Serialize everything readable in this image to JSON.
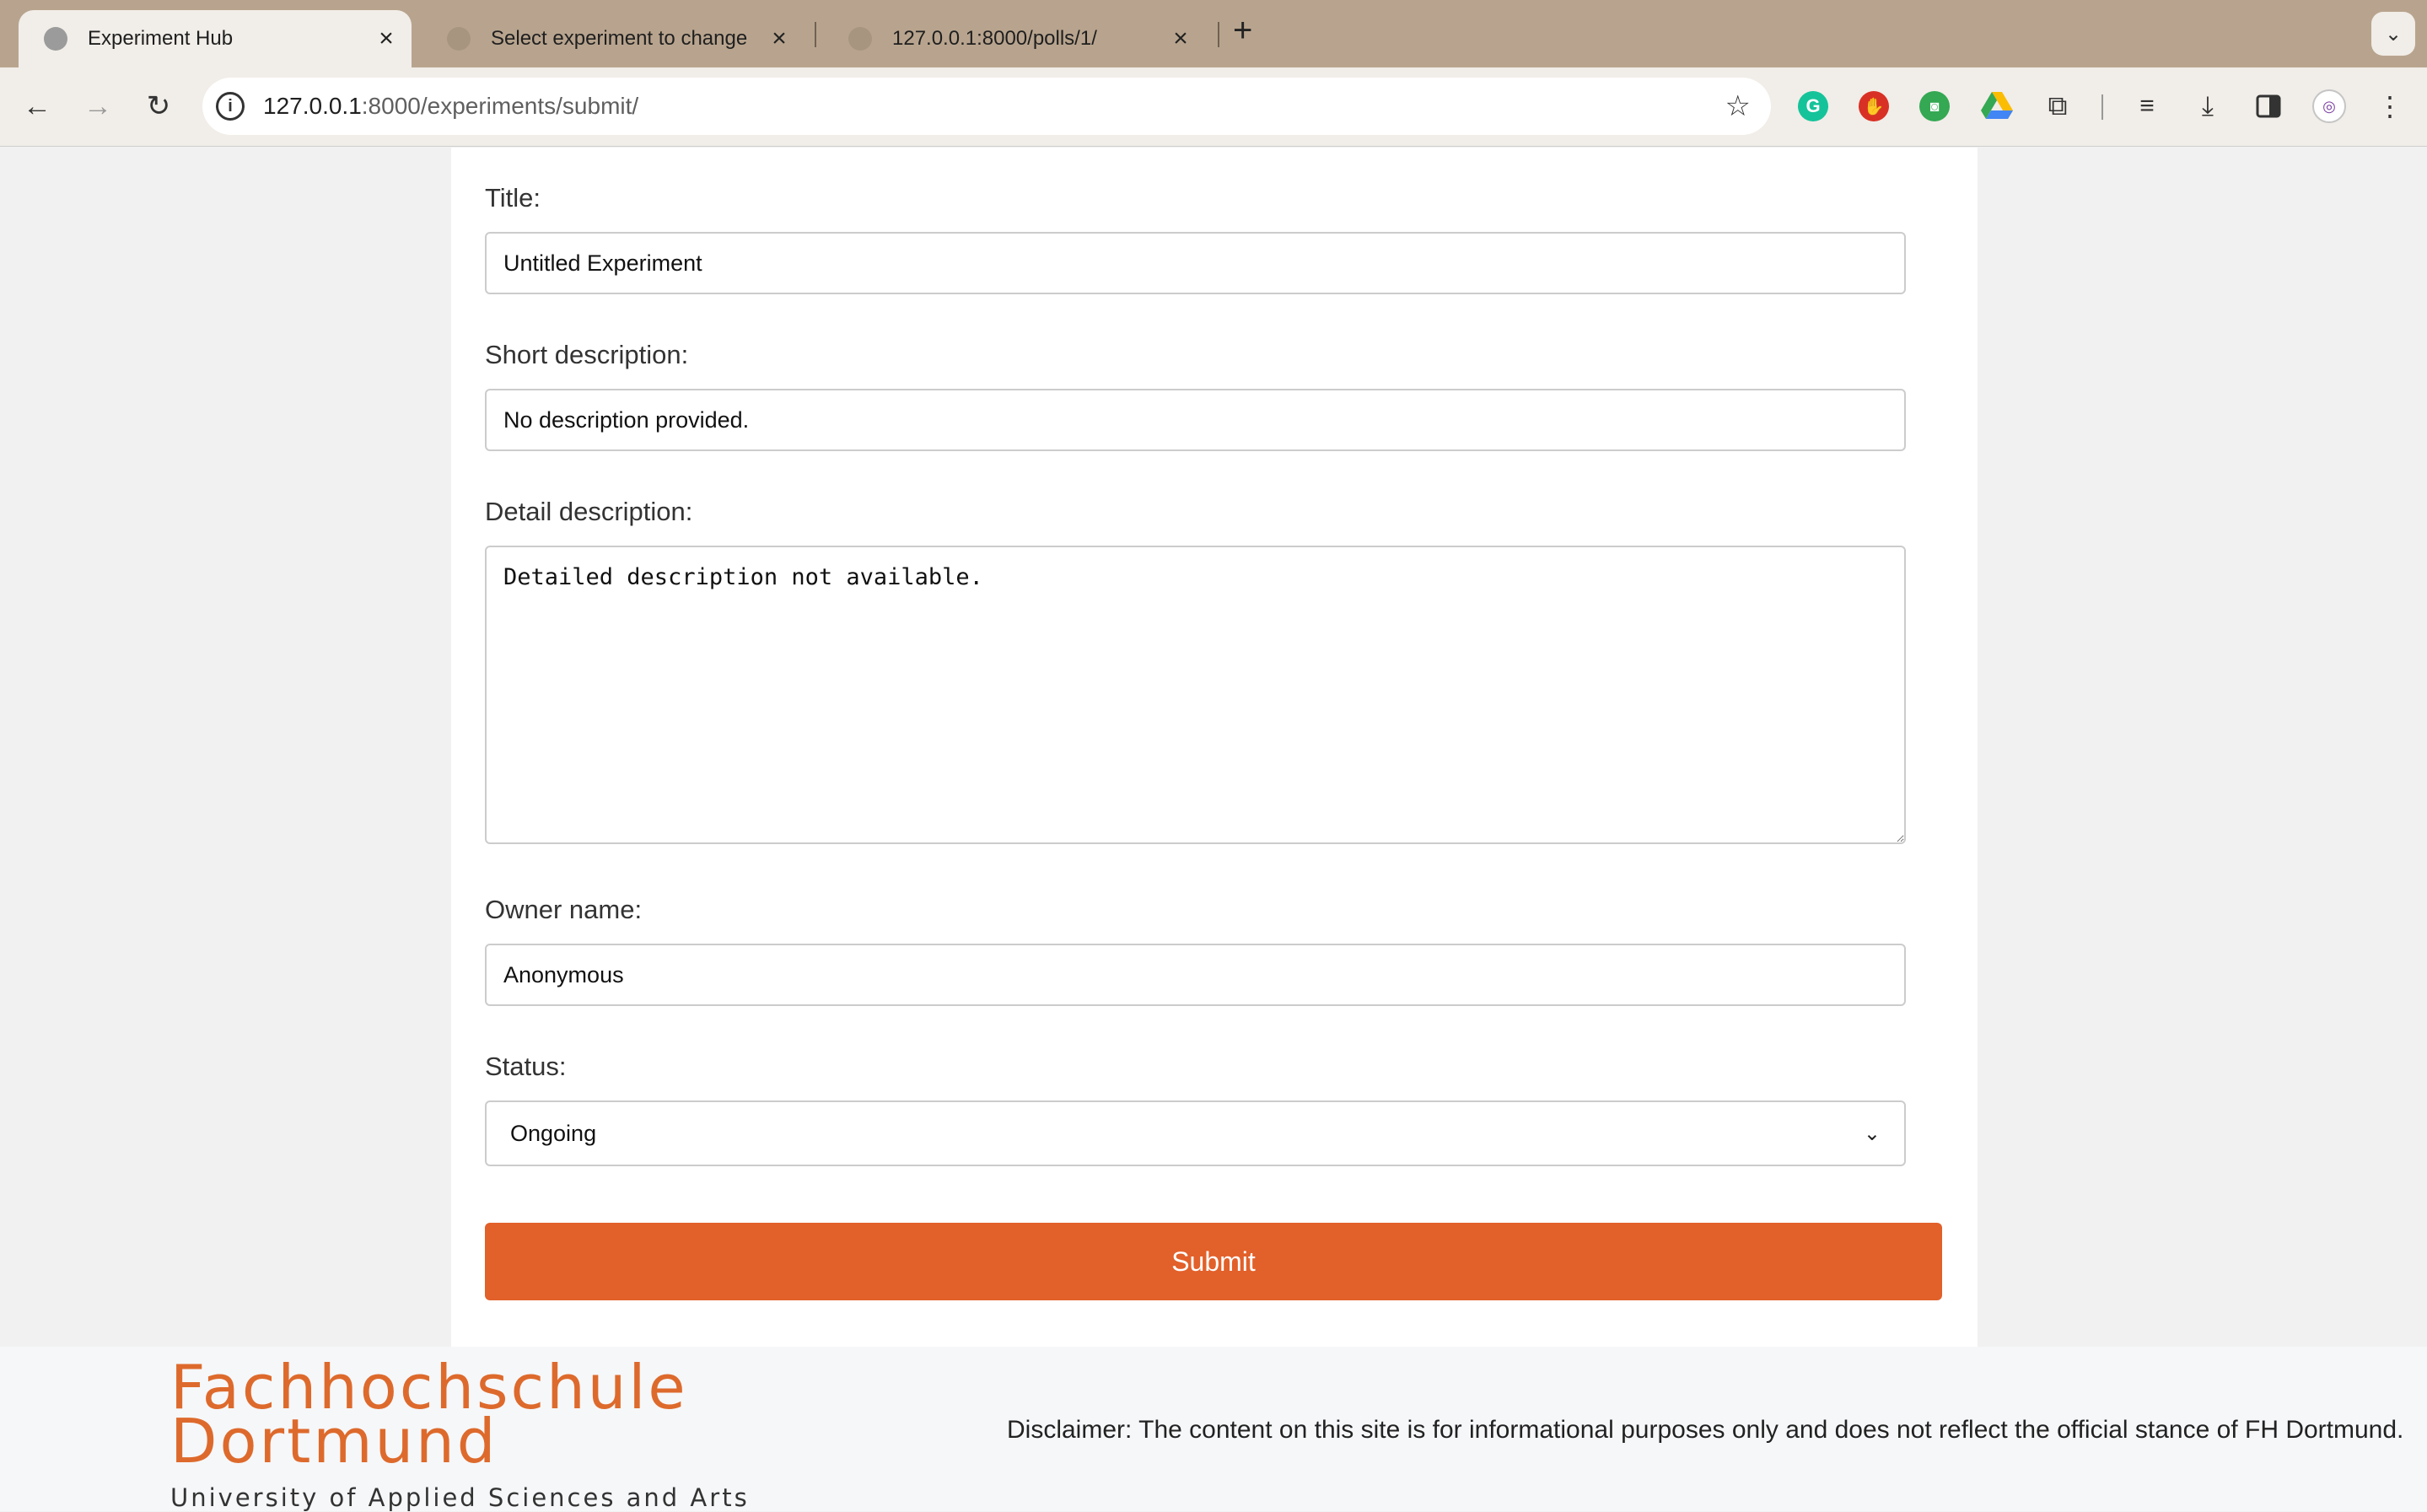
{
  "browser": {
    "tabs": [
      {
        "title": "Experiment Hub",
        "active": true
      },
      {
        "title": "Select experiment to change",
        "active": false
      },
      {
        "title": "127.0.0.1:8000/polls/1/",
        "active": false
      }
    ],
    "new_tab_label": "+",
    "url_host": "127.0.0.1",
    "url_path": ":8000/experiments/submit/",
    "extensions": [
      "grammarly-icon",
      "stop-icon",
      "robot-icon",
      "drive-icon",
      "puzzle-icon",
      "reading-list-icon",
      "download-icon",
      "side-panel-icon",
      "profile-icon",
      "more-icon"
    ]
  },
  "form": {
    "title_label": "Title:",
    "title_value": "Untitled Experiment",
    "short_label": "Short description:",
    "short_value": "No description provided.",
    "detail_label": "Detail description:",
    "detail_value": "Detailed description not available.",
    "owner_label": "Owner name:",
    "owner_value": "Anonymous",
    "status_label": "Status:",
    "status_value": "Ongoing",
    "submit_label": "Submit"
  },
  "footer": {
    "logo_line1": "Fachhochschule",
    "logo_line2": "Dortmund",
    "logo_line3": "University of Applied Sciences and Arts",
    "disclaimer": "Disclaimer: The content on this site is for informational purposes only and does not reflect the official stance of FH Dortmund."
  },
  "colors": {
    "accent": "#e2602a",
    "tabstrip": "#b8a48e",
    "logo": "#dd6a2c"
  }
}
